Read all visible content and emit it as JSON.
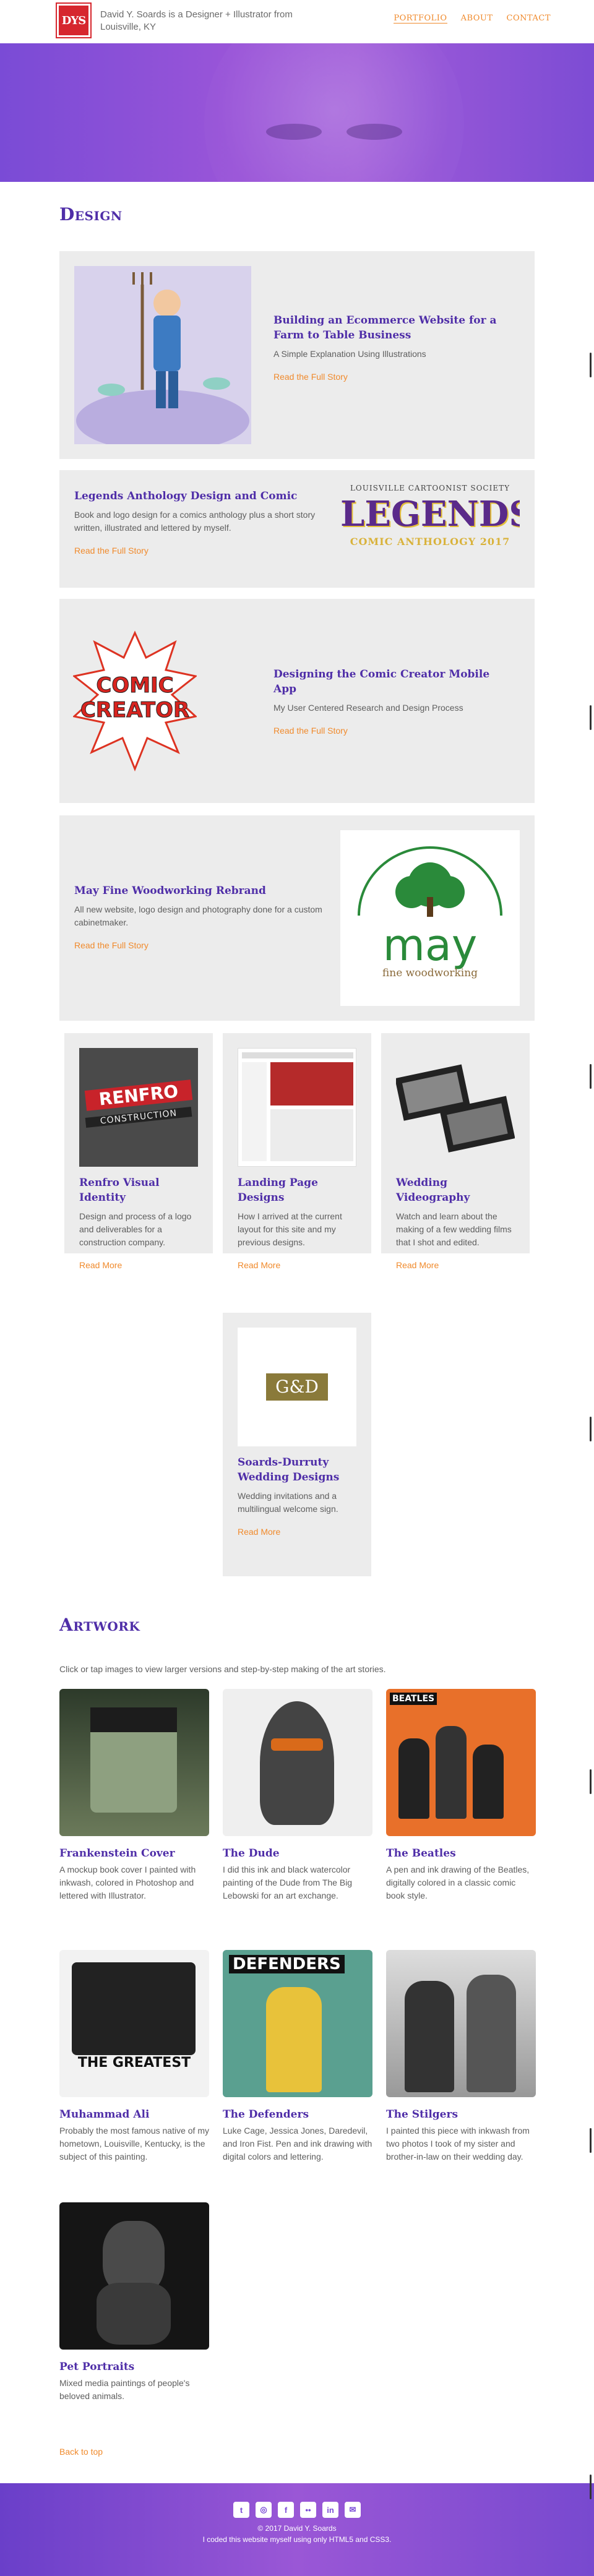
{
  "header": {
    "logo_text": "DYS",
    "tagline": "David Y. Soards is a Designer + Illustrator from Louisville, KY",
    "nav": [
      {
        "label": "PORTFOLIO",
        "active": true
      },
      {
        "label": "ABOUT",
        "active": false
      },
      {
        "label": "CONTACT",
        "active": false
      }
    ]
  },
  "design": {
    "title": "Design",
    "featured": [
      {
        "title": "Building an Ecommerce Website for a Farm to Table Business",
        "description": "A Simple Explanation Using Illustrations",
        "link": "Read the Full Story"
      },
      {
        "title": "Legends Anthology Design and Comic",
        "description": "Book and logo design for a comics anthology plus a short story written, illustrated and lettered by myself.",
        "link": "Read the Full Story",
        "art_line1": "LOUISVILLE CARTOONIST SOCIETY",
        "art_line2": "LEGENDS",
        "art_line3": "COMIC ANTHOLOGY 2017"
      },
      {
        "title": "Designing the Comic Creator Mobile App",
        "description": "My User Centered Research and Design Process",
        "link": "Read the Full Story",
        "art_line1": "COMIC",
        "art_line2": "CREATOR"
      },
      {
        "title": "May Fine Woodworking Rebrand",
        "description": "All new website, logo design and photography done for a custom cabinetmaker.",
        "link": "Read the Full Story",
        "art_line1": "may",
        "art_line2": "fine woodworking"
      }
    ],
    "small": [
      {
        "title": "Renfro Visual Identity",
        "description": "Design and process of a logo and deliverables for a construction company.",
        "link": "Read More",
        "art_line1": "RENFRO",
        "art_line2": "CONSTRUCTION"
      },
      {
        "title": "Landing Page Designs",
        "description": "How I arrived at the current layout for this site and my previous designs.",
        "link": "Read More"
      },
      {
        "title": "Wedding Videography",
        "description": "Watch and learn about the making of a few wedding films that I shot and edited.",
        "link": "Read More"
      },
      {
        "title": "Soards-Durruty Wedding Designs",
        "description": "Wedding invitations and a multilingual welcome sign.",
        "link": "Read More",
        "art_line1": "G&D"
      }
    ]
  },
  "artwork": {
    "title": "Artwork",
    "intro": "Click or tap images to view larger versions and step-by-step making of the art stories.",
    "items": [
      {
        "title": "Frankenstein Cover",
        "description": "A mockup book cover I painted with inkwash, colored in Photoshop and lettered with Illustrator."
      },
      {
        "title": "The Dude",
        "description": "I did this ink and black watercolor painting of the Dude from The Big Lebowski for an art exchange."
      },
      {
        "title": "The Beatles",
        "description": "A pen and ink drawing of the Beatles, digitally colored in a classic comic book style.",
        "art_line1": "BEATLES"
      },
      {
        "title": "Muhammad Ali",
        "description": "Probably the most famous native of my hometown, Louisville, Kentucky, is the subject of this painting.",
        "art_line1": "THE GREATEST"
      },
      {
        "title": "The Defenders",
        "description": "Luke Cage, Jessica Jones, Daredevil, and Iron Fist. Pen and ink drawing with digital colors and lettering.",
        "art_line1": "DEFENDERS"
      },
      {
        "title": "The Stilgers",
        "description": "I painted this piece with inkwash from two photos I took of my sister and brother-in-law on their wedding day."
      },
      {
        "title": "Pet Portraits",
        "description": "Mixed media paintings of people's beloved animals."
      }
    ]
  },
  "back_to_top": "Back to top",
  "footer": {
    "socials": [
      "twitter-icon",
      "instagram-icon",
      "facebook-icon",
      "flickr-icon",
      "linkedin-icon",
      "email-icon"
    ],
    "copyright": "© 2017 David Y. Soards",
    "note": "I coded this website myself using only HTML5 and CSS3."
  },
  "colors": {
    "accent": "#f08a2c",
    "heading": "#4f2ea8",
    "purple": "#8a50d6",
    "card": "#ececec"
  }
}
